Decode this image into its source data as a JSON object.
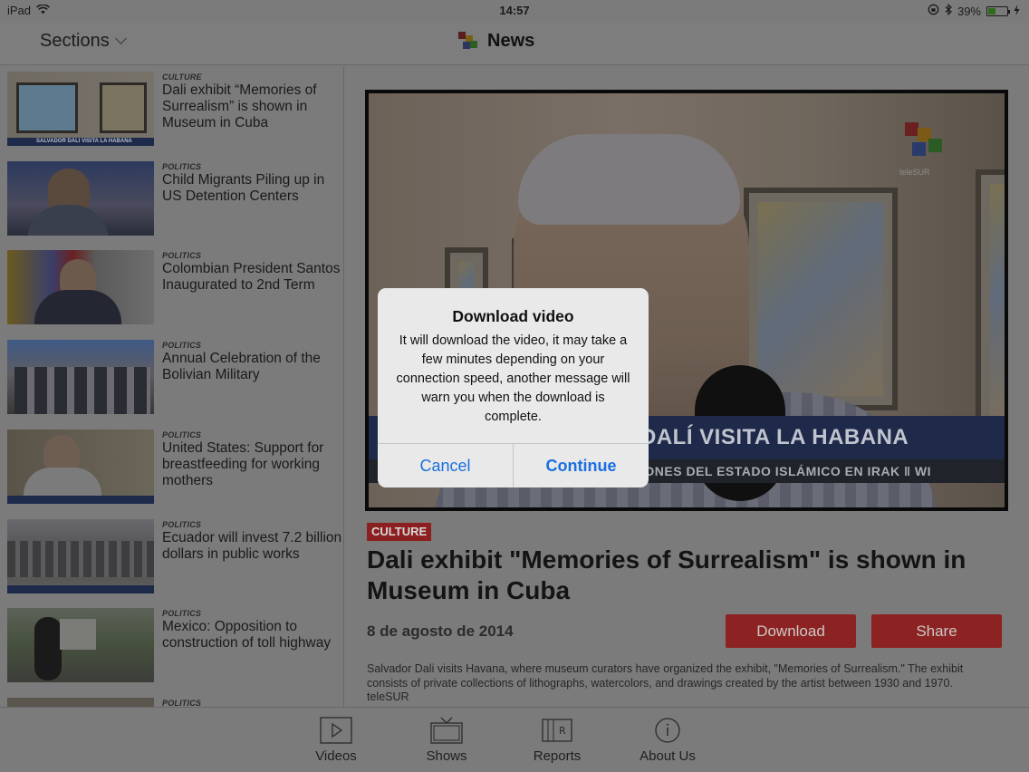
{
  "status": {
    "device": "iPad",
    "time": "14:57",
    "battery": "39%",
    "battery_level": 0.39
  },
  "nav": {
    "sections_label": "Sections",
    "title": "News"
  },
  "sidebar": {
    "items": [
      {
        "category": "CULTURE",
        "headline": "Dali exhibit “Memories of Surrealism” is shown in Museum in Cuba",
        "thumb_caption": "SALVADOR DALI VISITA LA HABANA"
      },
      {
        "category": "POLITICS",
        "headline": "Child Migrants Piling up in US Detention Centers"
      },
      {
        "category": "POLITICS",
        "headline": "Colombian President Santos Inaugurated to 2nd Term"
      },
      {
        "category": "POLITICS",
        "headline": "Annual Celebration of the Bolivian Military"
      },
      {
        "category": "POLITICS",
        "headline": "United States: Support for breastfeeding for working mothers"
      },
      {
        "category": "POLITICS",
        "headline": "Ecuador will invest 7.2 billion dollars in public works"
      },
      {
        "category": "POLITICS",
        "headline": "Mexico: Opposition to construction of toll highway"
      },
      {
        "category": "POLITICS",
        "headline": ""
      }
    ]
  },
  "article": {
    "video": {
      "ticker_main": "DALÍ VISITA LA HABANA",
      "ticker_sub": "IONES DEL ESTADO ISLÁMICO EN IRAK ‖ WI",
      "channel_logo": "teleSUR"
    },
    "category": "CULTURE",
    "title": "Dali exhibit \"Memories of Surrealism\" is shown in Museum in Cuba",
    "date": "8 de agosto de 2014",
    "download_label": "Download",
    "share_label": "Share",
    "body": "Salvador Dali visits Havana, where museum curators have organized the exhibit, \"Memories of Surrealism.\" The exhibit consists of private collections of lithographs, watercolors, and drawings created by the artist between 1930 and 1970.",
    "source": "teleSUR"
  },
  "tabs": [
    {
      "label": "Videos",
      "icon": "play-icon"
    },
    {
      "label": "Shows",
      "icon": "tv-icon"
    },
    {
      "label": "Reports",
      "icon": "reports-icon"
    },
    {
      "label": "About Us",
      "icon": "info-icon"
    }
  ],
  "alert": {
    "title": "Download video",
    "message": "It will download the video, it may take a few minutes depending on your connection speed, another message will warn you when the download is complete.",
    "cancel_label": "Cancel",
    "continue_label": "Continue"
  },
  "colors": {
    "accent_red": "#8d2222",
    "ios_blue": "#1b6fe0",
    "dim_overlay": "#7b7b7b"
  }
}
